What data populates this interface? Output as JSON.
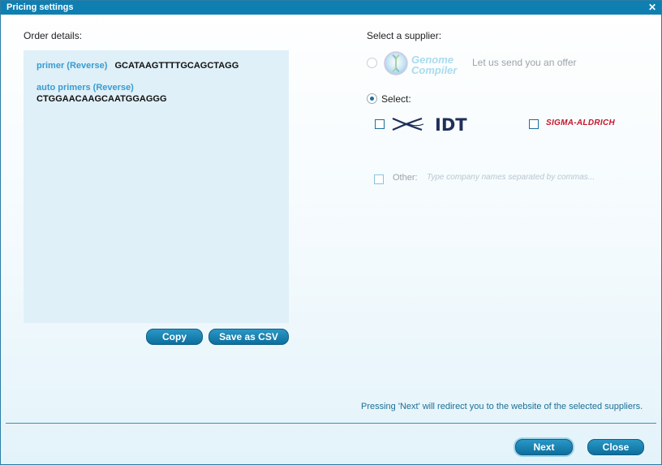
{
  "window": {
    "title": "Pricing settings",
    "close_glyph": "✕"
  },
  "order": {
    "heading": "Order details:",
    "items": [
      {
        "label": "primer (Reverse)",
        "sequence": "GCATAAGTTTTGCAGCTAGG"
      },
      {
        "label": "auto primers (Reverse)",
        "sequence": "CTGGAACAAGCAATGGAGGG"
      }
    ],
    "copy_label": "Copy",
    "csv_label": "Save as CSV"
  },
  "supplier": {
    "heading": "Select a supplier:",
    "genome_compiler": {
      "line1": "Genome",
      "line2": "Compiler",
      "offer_text": "Let us send you an offer",
      "selected": false,
      "enabled": false
    },
    "select_option": {
      "label": "Select:",
      "selected": true
    },
    "vendors": [
      {
        "name": "IDT",
        "checked": false
      },
      {
        "name": "SIGMA-ALDRICH",
        "checked": false
      }
    ],
    "other": {
      "label": "Other:",
      "placeholder": "Type company names separated by commas..."
    }
  },
  "footer": {
    "note": "Pressing 'Next' will redirect you to the website of the selected suppliers.",
    "next_label": "Next",
    "close_label": "Close"
  },
  "colors": {
    "titlebar": "#0f7fb2",
    "accent": "#1a6fa0",
    "sigma_red": "#c4162a",
    "idt_navy": "#1f2f5a"
  },
  "icons": [
    "close-icon",
    "genome-compiler-logo",
    "idt-logo",
    "sigma-aldrich-logo"
  ]
}
